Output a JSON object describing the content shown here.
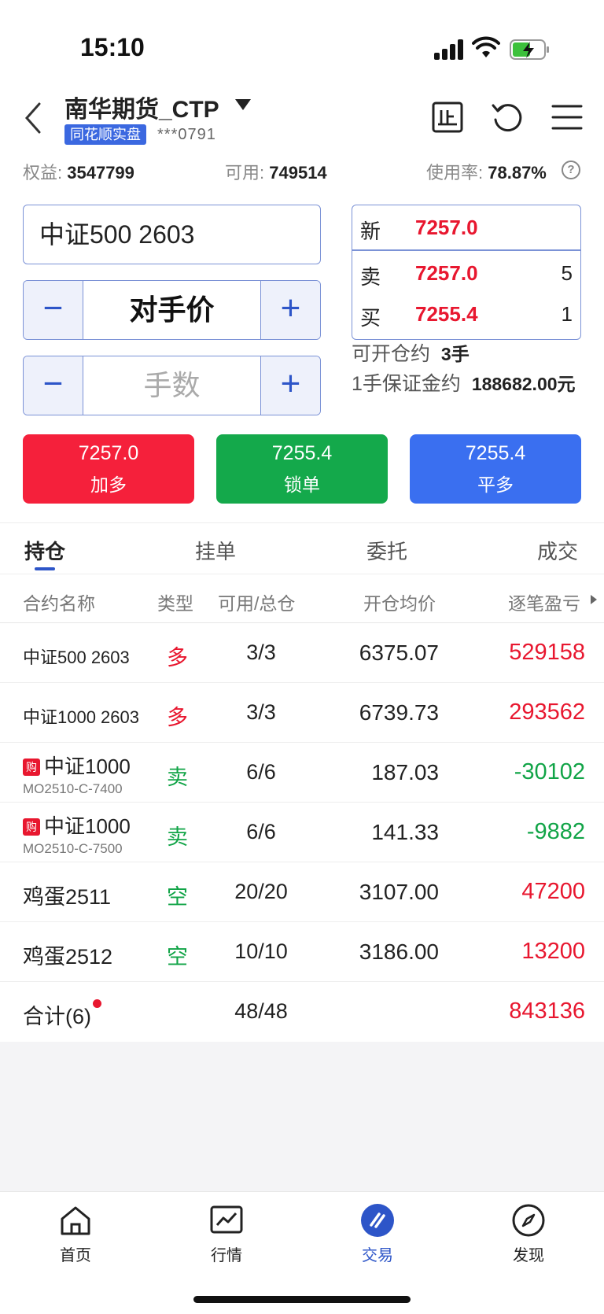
{
  "status_bar": {
    "time": "15:10"
  },
  "header": {
    "account_name": "南华期货_CTP",
    "badge": "同花顺实盘",
    "account_id": "***0791"
  },
  "summary": {
    "equity_label": "权益:",
    "equity_value": "3547799",
    "available_label": "可用:",
    "available_value": "749514",
    "usage_label": "使用率:",
    "usage_value": "78.87%"
  },
  "order_form": {
    "contract": "中证500 2603",
    "price_mode": "对手价",
    "quantity_placeholder": "手数",
    "minus": "−",
    "plus": "+",
    "quote": {
      "last_label": "新",
      "last_price": "7257.0",
      "ask_label": "卖",
      "ask_price": "7257.0",
      "ask_volume": "5",
      "bid_label": "买",
      "bid_price": "7255.4",
      "bid_volume": "1"
    },
    "can_open_label": "可开仓约",
    "can_open_value": "3手",
    "margin_label": "1手保证金约",
    "margin_value": "188682.00元",
    "buttons": [
      {
        "price": "7257.0",
        "label": "加多",
        "color": "#f5203b"
      },
      {
        "price": "7255.4",
        "label": "锁单",
        "color": "#14a94b"
      },
      {
        "price": "7255.4",
        "label": "平多",
        "color": "#3a6ff0"
      }
    ]
  },
  "tabs": [
    "持仓",
    "挂单",
    "委托",
    "成交"
  ],
  "table": {
    "headers": [
      "合约名称",
      "类型",
      "可用/总仓",
      "开仓均价",
      "逐笔盈亏"
    ],
    "rows": [
      {
        "name": "中证500 2603",
        "type": "多",
        "qty": "3/3",
        "avg": "6375.07",
        "pnl": "529158"
      },
      {
        "name": "中证1000 2603",
        "type": "多",
        "qty": "3/3",
        "avg": "6739.73",
        "pnl": "293562"
      },
      {
        "tag": "购",
        "name": "中证1000",
        "code": "MO2510-C-7400",
        "type": "卖",
        "qty": "6/6",
        "avg": "187.03",
        "pnl": "-30102"
      },
      {
        "tag": "购",
        "name": "中证1000",
        "code": "MO2510-C-7500",
        "type": "卖",
        "qty": "6/6",
        "avg": "141.33",
        "pnl": "-9882"
      },
      {
        "name": "鸡蛋2511",
        "type": "空",
        "qty": "20/20",
        "avg": "3107.00",
        "pnl": "47200"
      },
      {
        "name": "鸡蛋2512",
        "type": "空",
        "qty": "10/10",
        "avg": "3186.00",
        "pnl": "13200"
      }
    ],
    "total": {
      "label": "合计(6)",
      "qty": "48/48",
      "pnl": "843136"
    }
  },
  "bottom_nav": [
    {
      "label": "首页",
      "icon": "home-icon"
    },
    {
      "label": "行情",
      "icon": "chart-icon"
    },
    {
      "label": "交易",
      "icon": "trade-icon"
    },
    {
      "label": "发现",
      "icon": "compass-icon"
    }
  ],
  "colors": {
    "accent": "#2d55c8",
    "up": "#e8172f",
    "down": "#11a447"
  }
}
